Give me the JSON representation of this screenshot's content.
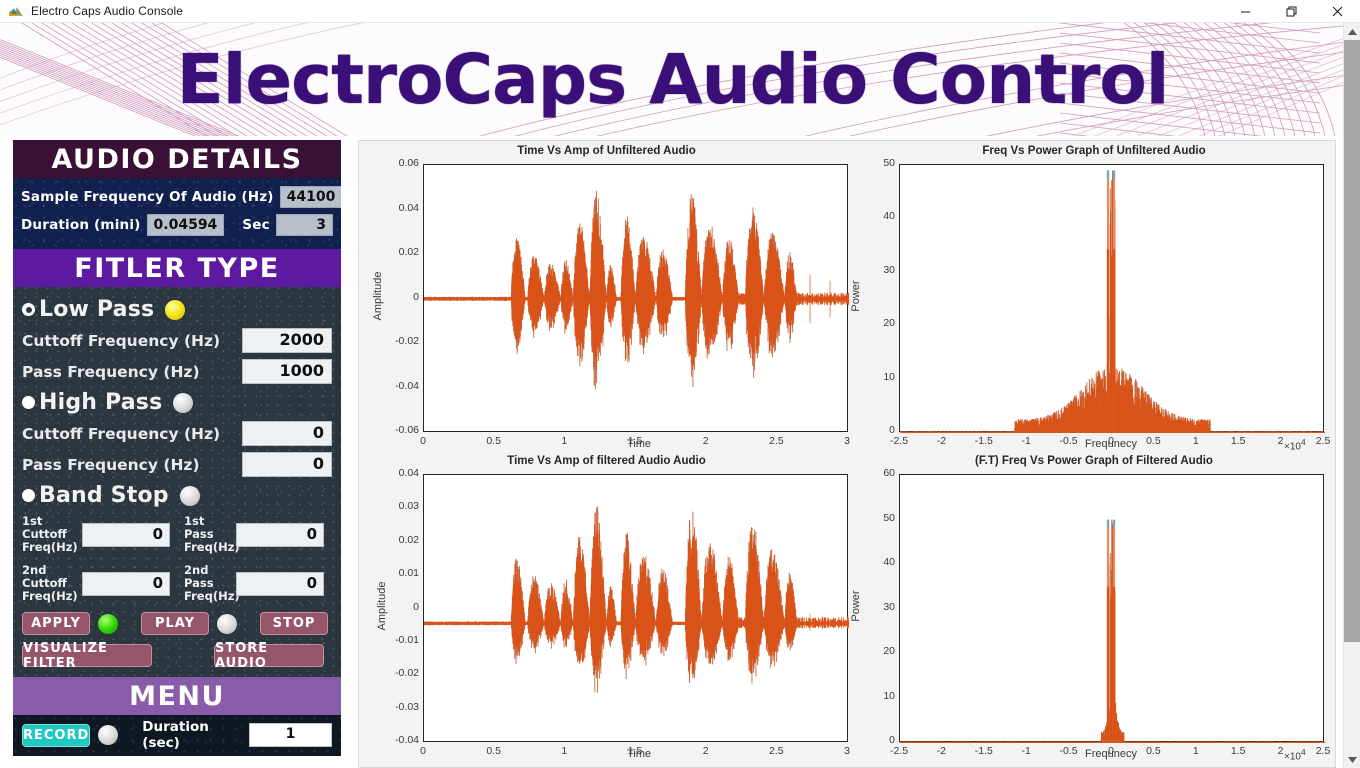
{
  "window": {
    "title": "Electro Caps Audio Console",
    "app_icon": "matlab-icon",
    "minimize": "minimize-icon",
    "maximize": "restore-icon",
    "close": "close-icon"
  },
  "banner": {
    "title": "ElectroCaps Audio Control",
    "title_color": "#3b0f78",
    "pattern_color": "#c07ba8"
  },
  "sidebar": {
    "audio_details": {
      "header": "AUDIO DETAILS",
      "header_color": "#3a1136",
      "rows": [
        {
          "label": "Sample Frequency Of Audio (Hz)",
          "value": "44100"
        },
        {
          "label": "Duration (mini)",
          "value": "0.04594",
          "label2": "Sec",
          "value2": "3"
        }
      ]
    },
    "filter_type": {
      "header": "FITLER TYPE",
      "header_color": "#5d1aa0",
      "options": [
        {
          "name": "Low Pass",
          "selected": true,
          "lamp": "yellow",
          "cutoff_label": "Cuttoff Frequency  (Hz)",
          "cutoff_value": "2000",
          "pass_label": "Pass Frequency  (Hz)",
          "pass_value": "1000"
        },
        {
          "name": "High Pass",
          "selected": false,
          "lamp": "grey",
          "cutoff_label": "Cuttoff Frequency  (Hz)",
          "cutoff_value": "0",
          "pass_label": "Pass Frequency  (Hz)",
          "pass_value": "0"
        },
        {
          "name": "Band Stop",
          "selected": false,
          "lamp": "grey"
        }
      ],
      "band_stop_fields": [
        {
          "label": "1st Cuttoff Freq(Hz)",
          "value": "0"
        },
        {
          "label": "1st Pass Freq(Hz)",
          "value": "0"
        },
        {
          "label": "2nd Cuttoff Freq(Hz)",
          "value": "0"
        },
        {
          "label": "2nd Pass Freq(Hz)",
          "value": "0"
        }
      ],
      "buttons": {
        "apply": "APPLY",
        "play": "PLAY",
        "stop": "STOP",
        "visualize": "VISUALIZE FILTER",
        "store": "STORE AUDIO",
        "apply_lamp": "green",
        "play_lamp": "grey",
        "button_color": "#96566a"
      }
    },
    "menu": {
      "header": "MENU",
      "header_color": "#8a5ba8",
      "record_label": "RECORD",
      "record_color": "#1fc8c0",
      "record_lamp": "grey",
      "duration_label": "Duration (sec)",
      "duration_value": "1"
    }
  },
  "chart_data": [
    {
      "id": "time-unfiltered",
      "type": "line",
      "title": "Time Vs Amp of Unfiltered Audio",
      "xlabel": "Time",
      "ylabel": "Amplitude",
      "xlim": [
        0,
        3
      ],
      "ylim": [
        -0.06,
        0.06
      ],
      "xticks": [
        "0",
        "0.5",
        "1",
        "1.5",
        "2",
        "2.5",
        "3"
      ],
      "yticks": [
        "0.06",
        "0.04",
        "0.02",
        "0",
        "-0.02",
        "-0.04",
        "-0.06"
      ],
      "series": [
        {
          "name": "unfiltered waveform",
          "color": "#d95319"
        }
      ],
      "grid": false,
      "legend": "none"
    },
    {
      "id": "freq-unfiltered",
      "type": "line",
      "title": "Freq Vs Power Graph of Unfiltered Audio",
      "xlabel": "Frequnecy",
      "ylabel": "Power",
      "x_exponent": "×10",
      "x_exponent_sup": "4",
      "xlim": [
        -2.5,
        2.5
      ],
      "ylim": [
        0,
        50
      ],
      "xticks": [
        "-2.5",
        "-2",
        "-1.5",
        "-1",
        "-0.5",
        "0",
        "0.5",
        "1",
        "1.5",
        "2",
        "2.5"
      ],
      "yticks": [
        "50",
        "40",
        "30",
        "20",
        "10",
        "0"
      ],
      "series": [
        {
          "name": "unfiltered spectrum",
          "color": "#d95319",
          "peak_power": 49
        }
      ],
      "grid": false,
      "legend": "none"
    },
    {
      "id": "time-filtered",
      "type": "line",
      "title": "Time Vs Amp of filtered Audio Audio",
      "xlabel": "Time",
      "ylabel": "Amplitude",
      "xlim": [
        0,
        3
      ],
      "ylim": [
        -0.04,
        0.05
      ],
      "xticks": [
        "0",
        "0.5",
        "1",
        "1.5",
        "2",
        "2.5",
        "3"
      ],
      "yticks": [
        "0.04",
        "0.03",
        "0.02",
        "0.01",
        "0",
        "-0.01",
        "-0.02",
        "-0.03",
        "-0.04"
      ],
      "series": [
        {
          "name": "filtered waveform",
          "color": "#d95319"
        }
      ],
      "grid": false,
      "legend": "none"
    },
    {
      "id": "freq-filtered",
      "type": "line",
      "title": "(F.T) Freq Vs Power Graph of Filtered Audio",
      "xlabel": "Frequnecy",
      "ylabel": "Power",
      "x_exponent": "×10",
      "x_exponent_sup": "4",
      "xlim": [
        -2.5,
        2.5
      ],
      "ylim": [
        0,
        60
      ],
      "xticks": [
        "-2.5",
        "-2",
        "-1.5",
        "-1",
        "-0.5",
        "0",
        "0.5",
        "1",
        "1.5",
        "2",
        "2.5"
      ],
      "yticks": [
        "60",
        "50",
        "40",
        "30",
        "20",
        "10",
        "0"
      ],
      "series": [
        {
          "name": "filtered spectrum",
          "color": "#d95319",
          "peak_power": 50
        }
      ],
      "grid": false,
      "legend": "none"
    }
  ]
}
